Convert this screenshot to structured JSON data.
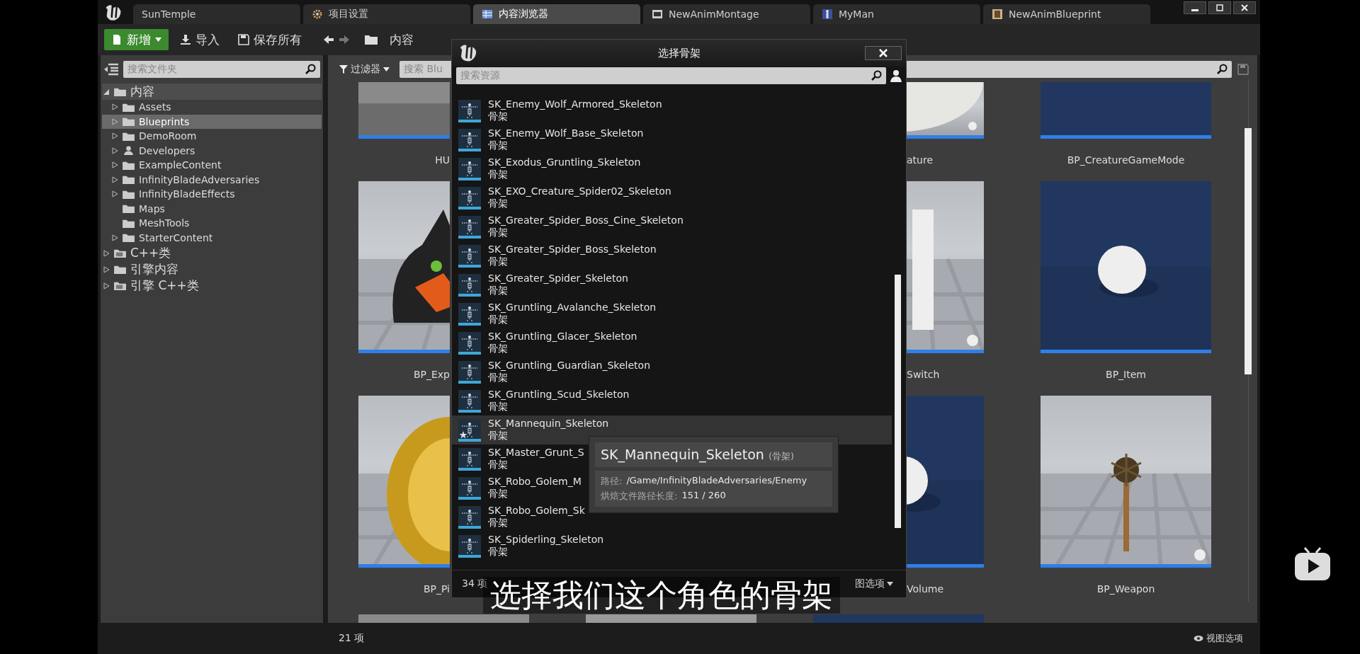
{
  "tabs": [
    {
      "label": "SunTemple",
      "kind": "plain",
      "selected": false
    },
    {
      "label": "项目设置",
      "kind": "settings",
      "selected": false
    },
    {
      "label": "内容浏览器",
      "kind": "browser",
      "selected": true
    },
    {
      "label": "NewAnimMontage",
      "kind": "montage",
      "selected": false
    },
    {
      "label": "MyMan",
      "kind": "mesh",
      "selected": false
    },
    {
      "label": "NewAnimBlueprint",
      "kind": "blueprint",
      "selected": false
    }
  ],
  "toolbar": {
    "new_button": "新增",
    "import_button": "导入",
    "save_all_button": "保存所有",
    "breadcrumb": "内容"
  },
  "folder_panel": {
    "search": {
      "placeholder": "搜索文件夹"
    },
    "tree": [
      {
        "label": "内容",
        "kind": "folder",
        "expanded": true,
        "selected": false,
        "children": [
          {
            "label": "Assets",
            "kind": "folder",
            "expandable": true,
            "selected": false
          },
          {
            "label": "Blueprints",
            "kind": "folder",
            "expandable": true,
            "selected": true
          },
          {
            "label": "DemoRoom",
            "kind": "folder",
            "expandable": true,
            "selected": false
          },
          {
            "label": "Developers",
            "kind": "person",
            "expandable": true,
            "selected": false
          },
          {
            "label": "ExampleContent",
            "kind": "folder",
            "expandable": true,
            "selected": false
          },
          {
            "label": "InfinityBladeAdversaries",
            "kind": "folder",
            "expandable": true,
            "selected": false
          },
          {
            "label": "InfinityBladeEffects",
            "kind": "folder",
            "expandable": true,
            "selected": false
          },
          {
            "label": "Maps",
            "kind": "folder",
            "expandable": false,
            "selected": false
          },
          {
            "label": "MeshTools",
            "kind": "folder",
            "expandable": false,
            "selected": false
          },
          {
            "label": "StarterContent",
            "kind": "folder",
            "expandable": true,
            "selected": false
          }
        ]
      },
      {
        "label": "C++类",
        "kind": "code",
        "expanded": false,
        "selected": false
      },
      {
        "label": "引擎内容",
        "kind": "folder",
        "expanded": false,
        "selected": false
      },
      {
        "label": "引擎 C++类",
        "kind": "code",
        "expanded": false,
        "selected": false
      }
    ]
  },
  "asset_panel": {
    "filter_button": "过滤器",
    "search": {
      "placeholder": "搜索 Blu"
    },
    "rows": [
      {
        "tiles": [
          {
            "label": "HU"
          },
          {
            "label": "ature"
          },
          {
            "label": "BP_CreatureGameMode"
          }
        ]
      },
      {
        "tiles": [
          {
            "label": "BP_Exp"
          },
          {
            "label": "Switch"
          },
          {
            "label": "BP_Item"
          }
        ]
      },
      {
        "tiles": [
          {
            "label": "BP_Pi"
          },
          {
            "label": "Volume"
          },
          {
            "label": "BP_Weapon"
          }
        ]
      }
    ]
  },
  "status_bar": {
    "count": "21 项",
    "view_options": "视图选项"
  },
  "dialog": {
    "title": "选择骨架",
    "search": {
      "placeholder": "搜索资源"
    },
    "items": [
      {
        "name": "SK_Enemy_Wolf_Armored_Skeleton",
        "type": "骨架",
        "highlighted": false,
        "starred": false
      },
      {
        "name": "SK_Enemy_Wolf_Base_Skeleton",
        "type": "骨架",
        "highlighted": false,
        "starred": false
      },
      {
        "name": "SK_Exodus_Gruntling_Skeleton",
        "type": "骨架",
        "highlighted": false,
        "starred": false
      },
      {
        "name": "SK_EXO_Creature_Spider02_Skeleton",
        "type": "骨架",
        "highlighted": false,
        "starred": false
      },
      {
        "name": "SK_Greater_Spider_Boss_Cine_Skeleton",
        "type": "骨架",
        "highlighted": false,
        "starred": false
      },
      {
        "name": "SK_Greater_Spider_Boss_Skeleton",
        "type": "骨架",
        "highlighted": false,
        "starred": false
      },
      {
        "name": "SK_Greater_Spider_Skeleton",
        "type": "骨架",
        "highlighted": false,
        "starred": false
      },
      {
        "name": "SK_Gruntling_Avalanche_Skeleton",
        "type": "骨架",
        "highlighted": false,
        "starred": false
      },
      {
        "name": "SK_Gruntling_Glacer_Skeleton",
        "type": "骨架",
        "highlighted": false,
        "starred": false
      },
      {
        "name": "SK_Gruntling_Guardian_Skeleton",
        "type": "骨架",
        "highlighted": false,
        "starred": false
      },
      {
        "name": "SK_Gruntling_Scud_Skeleton",
        "type": "骨架",
        "highlighted": false,
        "starred": false
      },
      {
        "name": "SK_Mannequin_Skeleton",
        "type": "骨架",
        "highlighted": true,
        "starred": true
      },
      {
        "name": "SK_Master_Grunt_S",
        "type": "骨架",
        "highlighted": false,
        "starred": false
      },
      {
        "name": "SK_Robo_Golem_M",
        "type": "骨架",
        "highlighted": false,
        "starred": false
      },
      {
        "name": "SK_Robo_Golem_Sk",
        "type": "骨架",
        "highlighted": false,
        "starred": false
      },
      {
        "name": "SK_Spiderling_Skeleton",
        "type": "骨架",
        "highlighted": false,
        "starred": false
      }
    ],
    "count": "34 项",
    "view_options": "图选项",
    "tooltip": {
      "name": "SK_Mannequin_Skeleton",
      "type": "(骨架)",
      "path_label": "路径:",
      "path": "/Game/InfinityBladeAdversaries/Enemy",
      "length_label": "烘焙文件路径长度:",
      "length": "151 / 260"
    }
  },
  "subtitle": "选择我们这个角色的骨架"
}
